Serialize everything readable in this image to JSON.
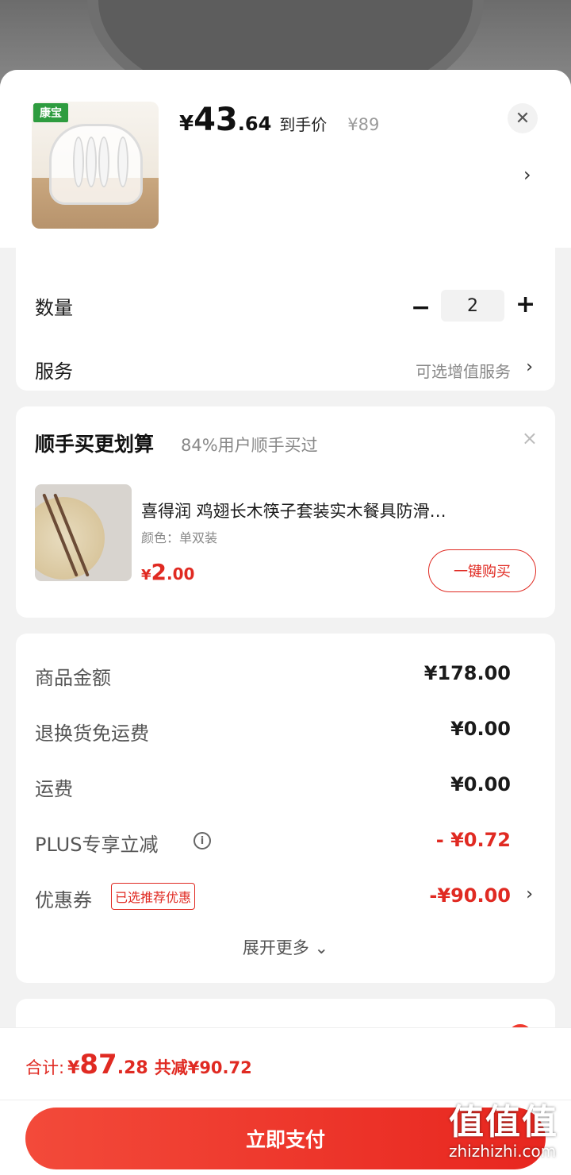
{
  "product": {
    "brand_logo_text": "康宝",
    "price_yen": "¥",
    "price_int": "43",
    "price_dec": ".64",
    "price_tag": "到手价",
    "original_price": "¥89",
    "close_icon": "close-icon",
    "chevron": "›"
  },
  "quantity": {
    "label": "数量",
    "minus": "−",
    "value": "2",
    "plus": "+"
  },
  "service": {
    "label": "服务",
    "hint": "可选增值服务",
    "chevron": "›"
  },
  "addon": {
    "title": "顺手买更划算",
    "subtitle": "84%用户顺手买过",
    "close": "×",
    "name": "喜得润 鸡翅长木筷子套装实木餐具防滑…",
    "spec": "颜色：单双装",
    "price_yen": "¥",
    "price_int": "2",
    "price_dec": ".00",
    "buy_label": "一键购买"
  },
  "fees": {
    "rows": [
      {
        "label": "商品金额",
        "value": "¥178.00"
      },
      {
        "label": "退换货免运费",
        "value": "¥0.00"
      },
      {
        "label": "运费",
        "value": "¥0.00"
      },
      {
        "label": "PLUS专享立减",
        "value": "- ¥0.72"
      },
      {
        "label": "优惠券",
        "value": "-¥90.00"
      }
    ],
    "info_icon": "i",
    "coupon_badge": "已选推荐优惠",
    "coupon_chevron": "›",
    "expand_label": "展开更多 ⌄"
  },
  "bottom": {
    "total_label": "合计:",
    "total_yen": "¥",
    "total_int": "87",
    "total_dec": ".28",
    "total_save": "共减¥90.72",
    "pay_label": "立即支付"
  },
  "watermark": {
    "big": "值值值",
    "small": "zhizhizhi.com"
  },
  "colors": {
    "accent_red": "#e02a22",
    "pay_button": "#e8261f"
  }
}
